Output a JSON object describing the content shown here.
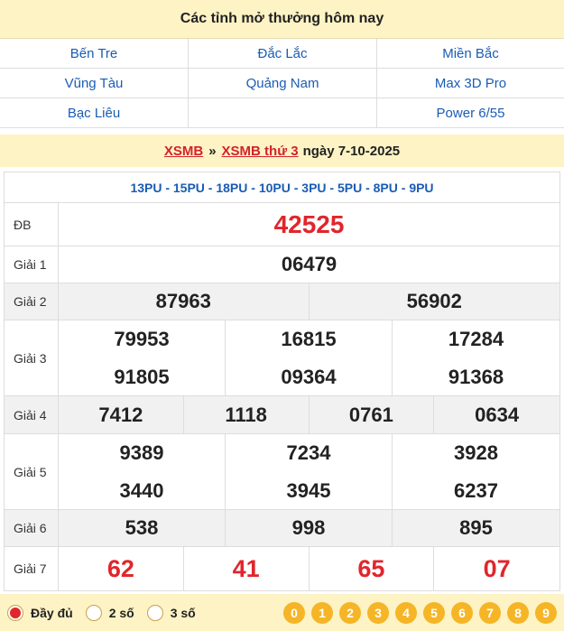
{
  "today": {
    "title": "Các tỉnh mở thưởng hôm nay",
    "provinces": [
      "Bến Tre",
      "Đắc Lắc",
      "Miền Bắc",
      "Vũng Tàu",
      "Quảng Nam",
      "Max 3D Pro",
      "Bạc Liêu",
      "",
      "Power 6/55"
    ]
  },
  "result_header": {
    "link1": "XSMB",
    "separator": "»",
    "link2": "XSMB thứ 3",
    "date_text": "ngày 7-10-2025"
  },
  "codes": "13PU - 15PU - 18PU - 10PU - 3PU - 5PU - 8PU - 9PU",
  "prizes": {
    "db": {
      "label": "ĐB",
      "values": [
        "42525"
      ]
    },
    "g1": {
      "label": "Giải 1",
      "values": [
        "06479"
      ]
    },
    "g2": {
      "label": "Giải 2",
      "values": [
        "87963",
        "56902"
      ]
    },
    "g3": {
      "label": "Giải 3",
      "values": [
        "79953",
        "16815",
        "17284",
        "91805",
        "09364",
        "91368"
      ]
    },
    "g4": {
      "label": "Giải 4",
      "values": [
        "7412",
        "1118",
        "0761",
        "0634"
      ]
    },
    "g5": {
      "label": "Giải 5",
      "values": [
        "9389",
        "7234",
        "3928",
        "3440",
        "3945",
        "6237"
      ]
    },
    "g6": {
      "label": "Giải 6",
      "values": [
        "538",
        "998",
        "895"
      ]
    },
    "g7": {
      "label": "Giải 7",
      "values": [
        "62",
        "41",
        "65",
        "07"
      ]
    }
  },
  "options": {
    "full": "Đầy đủ",
    "two": "2 số",
    "three": "3 số",
    "selected": "full"
  },
  "digits": [
    "0",
    "1",
    "2",
    "3",
    "4",
    "5",
    "6",
    "7",
    "8",
    "9"
  ],
  "colors": {
    "accent_red": "#e0262c",
    "link_blue": "#1a5cb4",
    "header_bg": "#fdf3c5",
    "digit_bg": "#f5b526"
  }
}
